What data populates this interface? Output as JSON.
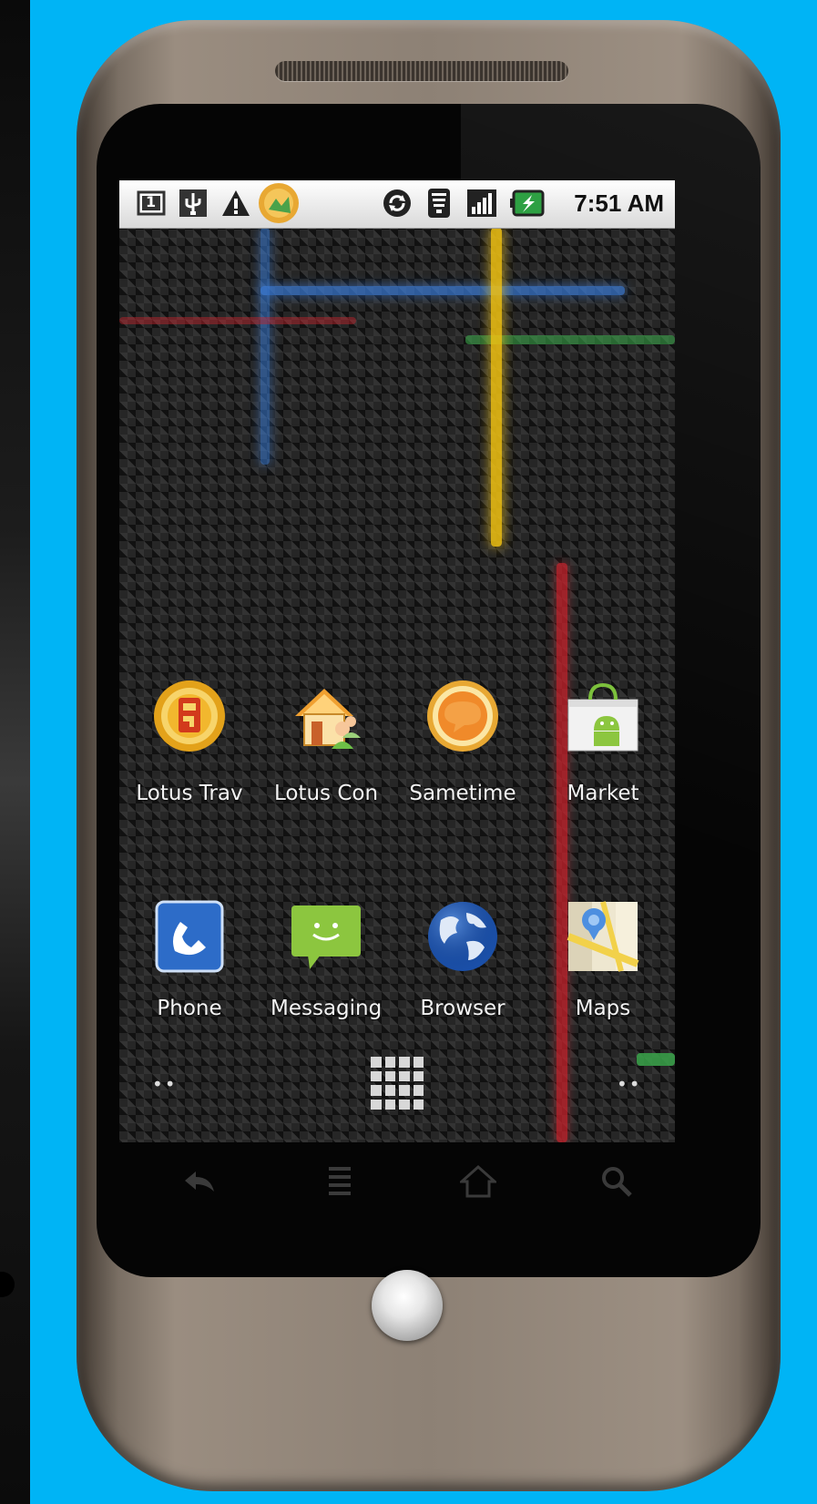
{
  "status_bar": {
    "clock": "7:51 AM",
    "left_icons": [
      "notification-count-icon",
      "usb-icon",
      "warning-icon",
      "lotus-app-notification-icon"
    ],
    "right_icons": [
      "sync-icon",
      "wifi-icon",
      "signal-icon",
      "battery-charging-icon"
    ],
    "notification_count": "1"
  },
  "home": {
    "row1": [
      {
        "label": "Lotus Trav",
        "icon": "lotus-traveler-icon"
      },
      {
        "label": "Lotus Con",
        "icon": "lotus-connections-icon"
      },
      {
        "label": "Sametime",
        "icon": "sametime-icon"
      },
      {
        "label": "Market",
        "icon": "market-icon"
      }
    ],
    "row2": [
      {
        "label": "Phone",
        "icon": "phone-icon"
      },
      {
        "label": "Messaging",
        "icon": "messaging-icon"
      },
      {
        "label": "Browser",
        "icon": "browser-icon"
      },
      {
        "label": "Maps",
        "icon": "maps-icon"
      }
    ],
    "page_dots_left": "••",
    "page_dots_right": "••"
  },
  "soft_keys": [
    "back-icon",
    "menu-icon",
    "home-icon",
    "search-icon"
  ],
  "colors": {
    "background": "#00b4f5",
    "phone_body": "#8d8175",
    "glow_blue": "#3a7bd5",
    "glow_yellow": "#f2c313",
    "glow_green": "#3aa34a",
    "glow_red": "#c8232c"
  }
}
